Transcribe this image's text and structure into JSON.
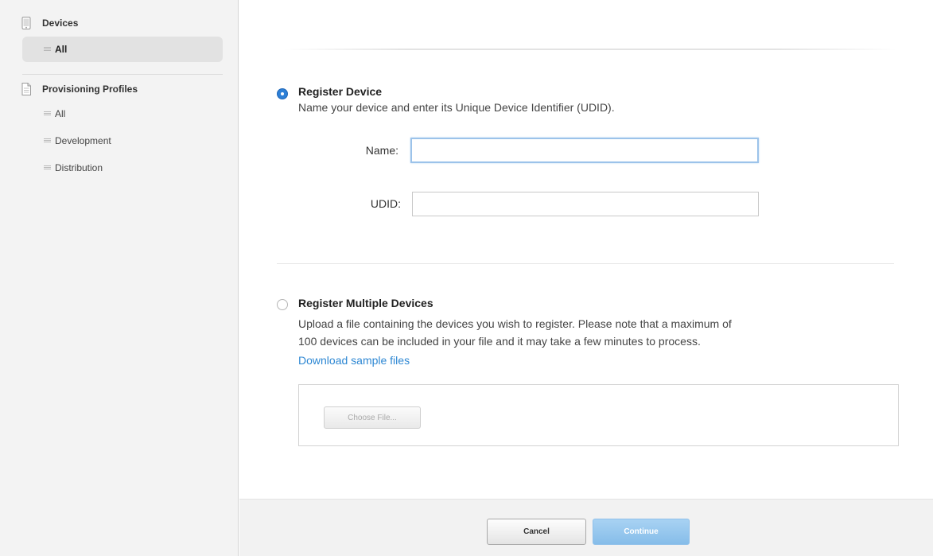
{
  "sidebar": {
    "devices": {
      "header_label": "Devices",
      "items": [
        {
          "label": "All",
          "selected": true
        }
      ]
    },
    "provisioning_profiles": {
      "header_label": "Provisioning Profiles",
      "items": [
        {
          "label": "All",
          "selected": false
        },
        {
          "label": "Development",
          "selected": false
        },
        {
          "label": "Distribution",
          "selected": false
        }
      ]
    }
  },
  "register_device": {
    "title": "Register Device",
    "description": "Name your device and enter its Unique Device Identifier (UDID).",
    "selected": true,
    "name_label": "Name:",
    "name_value": "",
    "udid_label": "UDID:",
    "udid_value": ""
  },
  "register_multiple": {
    "title": "Register Multiple Devices",
    "description_line1": "Upload a file containing the devices you wish to register. Please note that a maximum of",
    "description_line2": "100 devices can be included in your file and it may take a few minutes to process.",
    "download_link": "Download sample files",
    "choose_file_label": "Choose File...",
    "selected": false
  },
  "footer": {
    "cancel_label": "Cancel",
    "continue_label": "Continue"
  },
  "colors": {
    "accent": "#2d7fd6",
    "link": "#2d87d3",
    "continue_button": "#9ccaf0",
    "sidebar_bg": "#f3f3f3",
    "footer_bg": "#f2f2f2"
  },
  "icons": {
    "devices_group": "device-icon",
    "profiles_group": "document-icon",
    "list_bullet": "list-bullet-icon"
  }
}
